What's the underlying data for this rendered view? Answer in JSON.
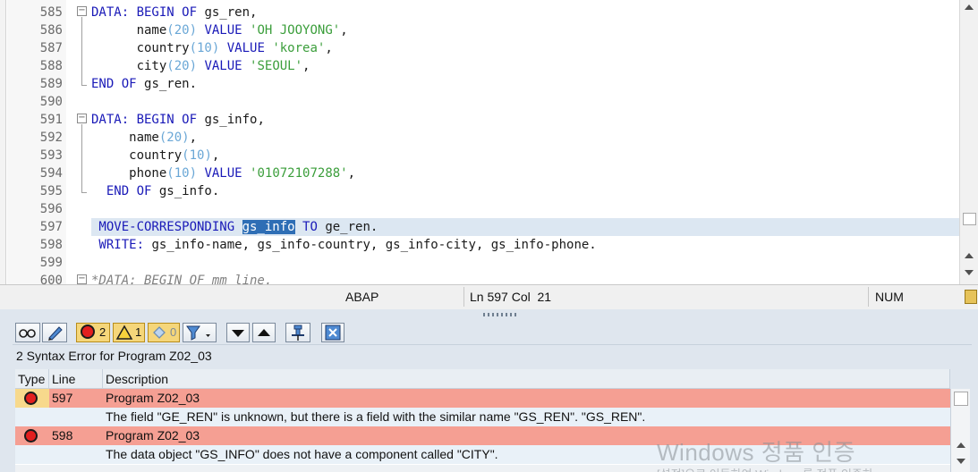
{
  "editor": {
    "lines": [
      {
        "num": "585",
        "tokens": [
          {
            "t": "kw",
            "v": "DATA: "
          },
          {
            "t": "kw",
            "v": "BEGIN OF "
          },
          {
            "t": "id",
            "v": "gs_ren,"
          }
        ]
      },
      {
        "num": "586",
        "tokens": [
          {
            "t": "id",
            "v": "      name"
          },
          {
            "t": "num",
            "v": "(20)"
          },
          {
            "t": "kw",
            "v": " VALUE "
          },
          {
            "t": "str",
            "v": "'OH JOOYONG'"
          },
          {
            "t": "id",
            "v": ","
          }
        ]
      },
      {
        "num": "587",
        "tokens": [
          {
            "t": "id",
            "v": "      country"
          },
          {
            "t": "num",
            "v": "(10)"
          },
          {
            "t": "kw",
            "v": " VALUE "
          },
          {
            "t": "str",
            "v": "'korea'"
          },
          {
            "t": "id",
            "v": ","
          }
        ]
      },
      {
        "num": "588",
        "tokens": [
          {
            "t": "id",
            "v": "      city"
          },
          {
            "t": "num",
            "v": "(20)"
          },
          {
            "t": "kw",
            "v": " VALUE "
          },
          {
            "t": "str",
            "v": "'SEOUL'"
          },
          {
            "t": "id",
            "v": ","
          }
        ]
      },
      {
        "num": "589",
        "tokens": [
          {
            "t": "kw",
            "v": "END OF "
          },
          {
            "t": "id",
            "v": "gs_ren."
          }
        ]
      },
      {
        "num": "590",
        "tokens": []
      },
      {
        "num": "591",
        "tokens": [
          {
            "t": "kw",
            "v": "DATA: "
          },
          {
            "t": "kw",
            "v": "BEGIN OF "
          },
          {
            "t": "id",
            "v": "gs_info,"
          }
        ]
      },
      {
        "num": "592",
        "tokens": [
          {
            "t": "id",
            "v": "     name"
          },
          {
            "t": "num",
            "v": "(20)"
          },
          {
            "t": "id",
            "v": ","
          }
        ]
      },
      {
        "num": "593",
        "tokens": [
          {
            "t": "id",
            "v": "     country"
          },
          {
            "t": "num",
            "v": "(10)"
          },
          {
            "t": "id",
            "v": ","
          }
        ]
      },
      {
        "num": "594",
        "tokens": [
          {
            "t": "id",
            "v": "     phone"
          },
          {
            "t": "num",
            "v": "(10)"
          },
          {
            "t": "kw",
            "v": " VALUE "
          },
          {
            "t": "str",
            "v": "'01072107288'"
          },
          {
            "t": "id",
            "v": ","
          }
        ]
      },
      {
        "num": "595",
        "tokens": [
          {
            "t": "kw",
            "v": "  END OF "
          },
          {
            "t": "id",
            "v": "gs_info."
          }
        ]
      },
      {
        "num": "596",
        "tokens": []
      },
      {
        "num": "597",
        "tokens": [
          {
            "t": "kw",
            "v": " MOVE-CORRESPONDING "
          },
          {
            "t": "sel",
            "v": "gs_info"
          },
          {
            "t": "kw",
            "v": " TO "
          },
          {
            "t": "id",
            "v": "ge_ren."
          }
        ]
      },
      {
        "num": "598",
        "tokens": [
          {
            "t": "kw",
            "v": " WRITE: "
          },
          {
            "t": "id",
            "v": "gs_info-name, gs_info-country, gs_info-city, gs_info-phone."
          }
        ]
      },
      {
        "num": "599",
        "tokens": []
      },
      {
        "num": "600",
        "tokens": [
          {
            "t": "cm",
            "v": "*DATA: BEGIN OF mm_line."
          }
        ]
      }
    ]
  },
  "status": {
    "language": "ABAP",
    "position": "Ln 597 Col  21",
    "mode": "NUM"
  },
  "toolbar": {
    "error_count": "2",
    "warning_count": "1",
    "info_count": "0"
  },
  "errors": {
    "title": "2 Syntax Error for Program Z02_03",
    "columns": {
      "type": "Type",
      "line": "Line",
      "description": "Description"
    },
    "rows": [
      {
        "line": "597",
        "program": "Program Z02_03",
        "message": "The field \"GE_REN\" is unknown, but there is a field with the similar name \"GS_REN\". \"GS_REN\"."
      },
      {
        "line": "598",
        "program": "Program Z02_03",
        "message": "The data object \"GS_INFO\" does not have a component called \"CITY\"."
      }
    ]
  },
  "watermark": {
    "line1": "Windows 정품 인증",
    "line2": "[설정]으로 이동하여 Windows를 정품 인증하"
  }
}
